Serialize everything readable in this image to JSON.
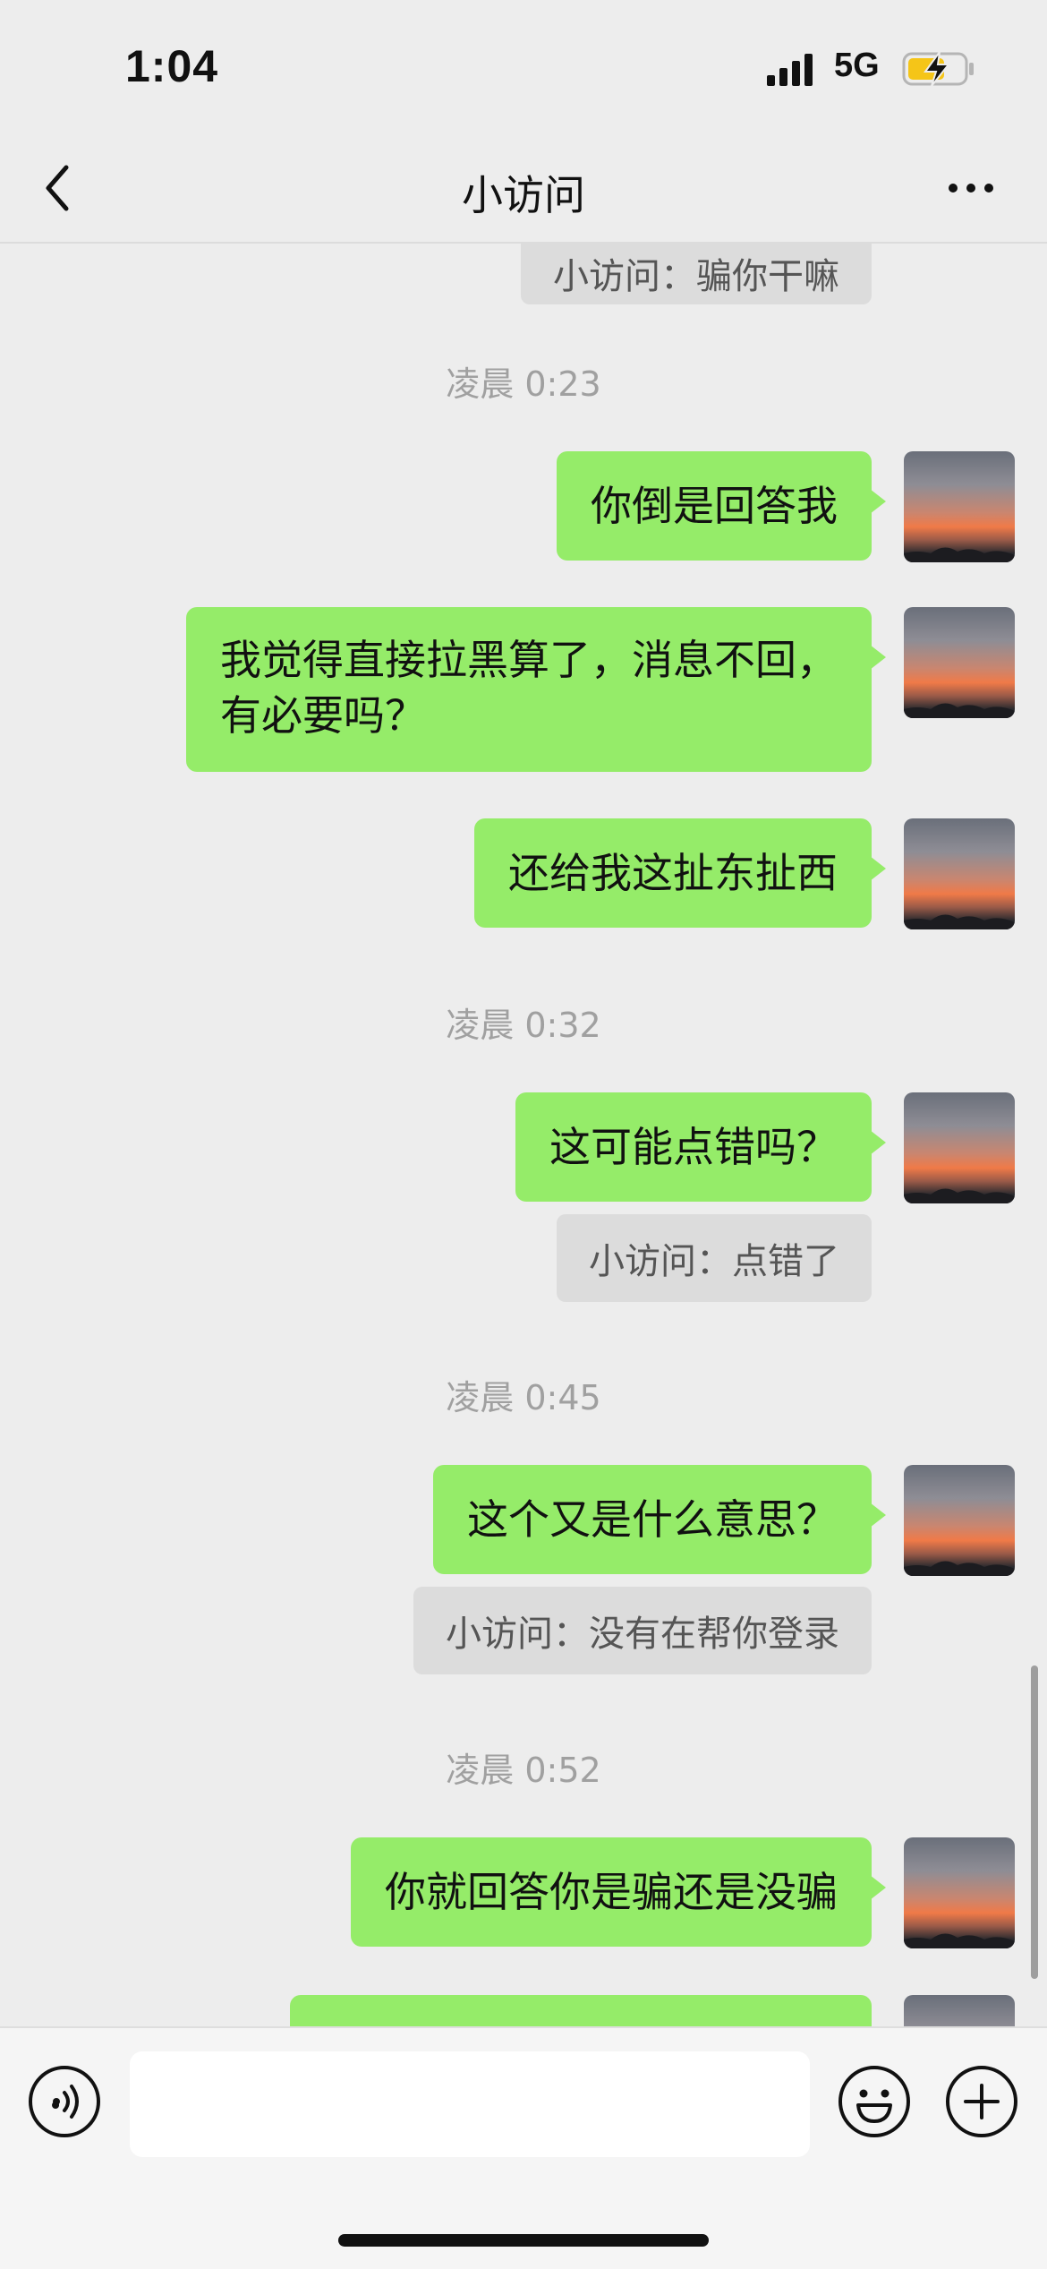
{
  "status_bar": {
    "time": "1:04",
    "network": "5G",
    "battery_color": "#f5c518"
  },
  "nav": {
    "title": "小访问",
    "back_icon": "chevron-left-icon",
    "more_icon": "more-dots-icon"
  },
  "messages": {
    "clipped_quote": "小访问：骗你干嘛",
    "t1": "凌晨 0:23",
    "m1": "你倒是回答我",
    "m2_line1": "我觉得直接拉黑算了，消息不回，",
    "m2_line2": "有必要吗？",
    "m3": "还给我这扯东扯西",
    "t2": "凌晨 0:32",
    "m4": "这可能点错吗？",
    "q1": "小访问：点错了",
    "t3": "凌晨 0:45",
    "m5": "这个又是什么意思？",
    "q2": "小访问：没有在帮你登录",
    "t4": "凌晨 0:52",
    "m6": "你就回答你是骗还是没骗"
  },
  "input": {
    "value": "",
    "placeholder": ""
  },
  "colors": {
    "bubble_green": "#95ec69",
    "background": "#ededed",
    "quote_gray": "#dcdcdc"
  }
}
